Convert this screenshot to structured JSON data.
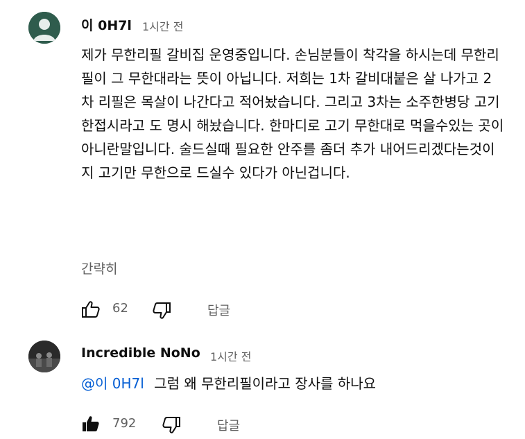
{
  "comments": [
    {
      "author": "이 0H7l",
      "time": "1시간 전",
      "avatar_color": "#2f5c4d",
      "text": "제가 무한리필 갈비집 운영중입니다. 손님분들이 착각을 하시는데 무한리필이 그 무한대라는 뜻이 아닙니다. 저희는 1차 갈비대붙은 살 나가고 2차 리필은 목살이 나간다고 적어놨습니다. 그리고 3차는 소주한병당 고기 한접시라고 도 명시 해놨습니다. 한마디로 고기 무한대로 먹을수있는 곳이 아니란말입니다. 술드실때 필요한 안주를 좀더 추가 내어드리겠다는것이지 고기만 무한으로 드실수 있다가 아닌겁니다.",
      "collapse_label": "간략히",
      "like_count": "62",
      "reply_label": "답글",
      "like_icon": "thumbs-up-outline-icon",
      "dislike_icon": "thumbs-down-outline-icon"
    },
    {
      "author": "Incredible NoNo",
      "time": "1시간 전",
      "mention": "@이 0H7l",
      "text": "그럼 왜 무한리필이라고 장사를 하나요",
      "like_count": "792",
      "reply_label": "답글",
      "like_icon": "thumbs-up-filled-icon",
      "dislike_icon": "thumbs-down-outline-icon"
    }
  ],
  "colors": {
    "link": "#065fd4",
    "secondary": "#606060",
    "primary": "#0f0f0f"
  }
}
